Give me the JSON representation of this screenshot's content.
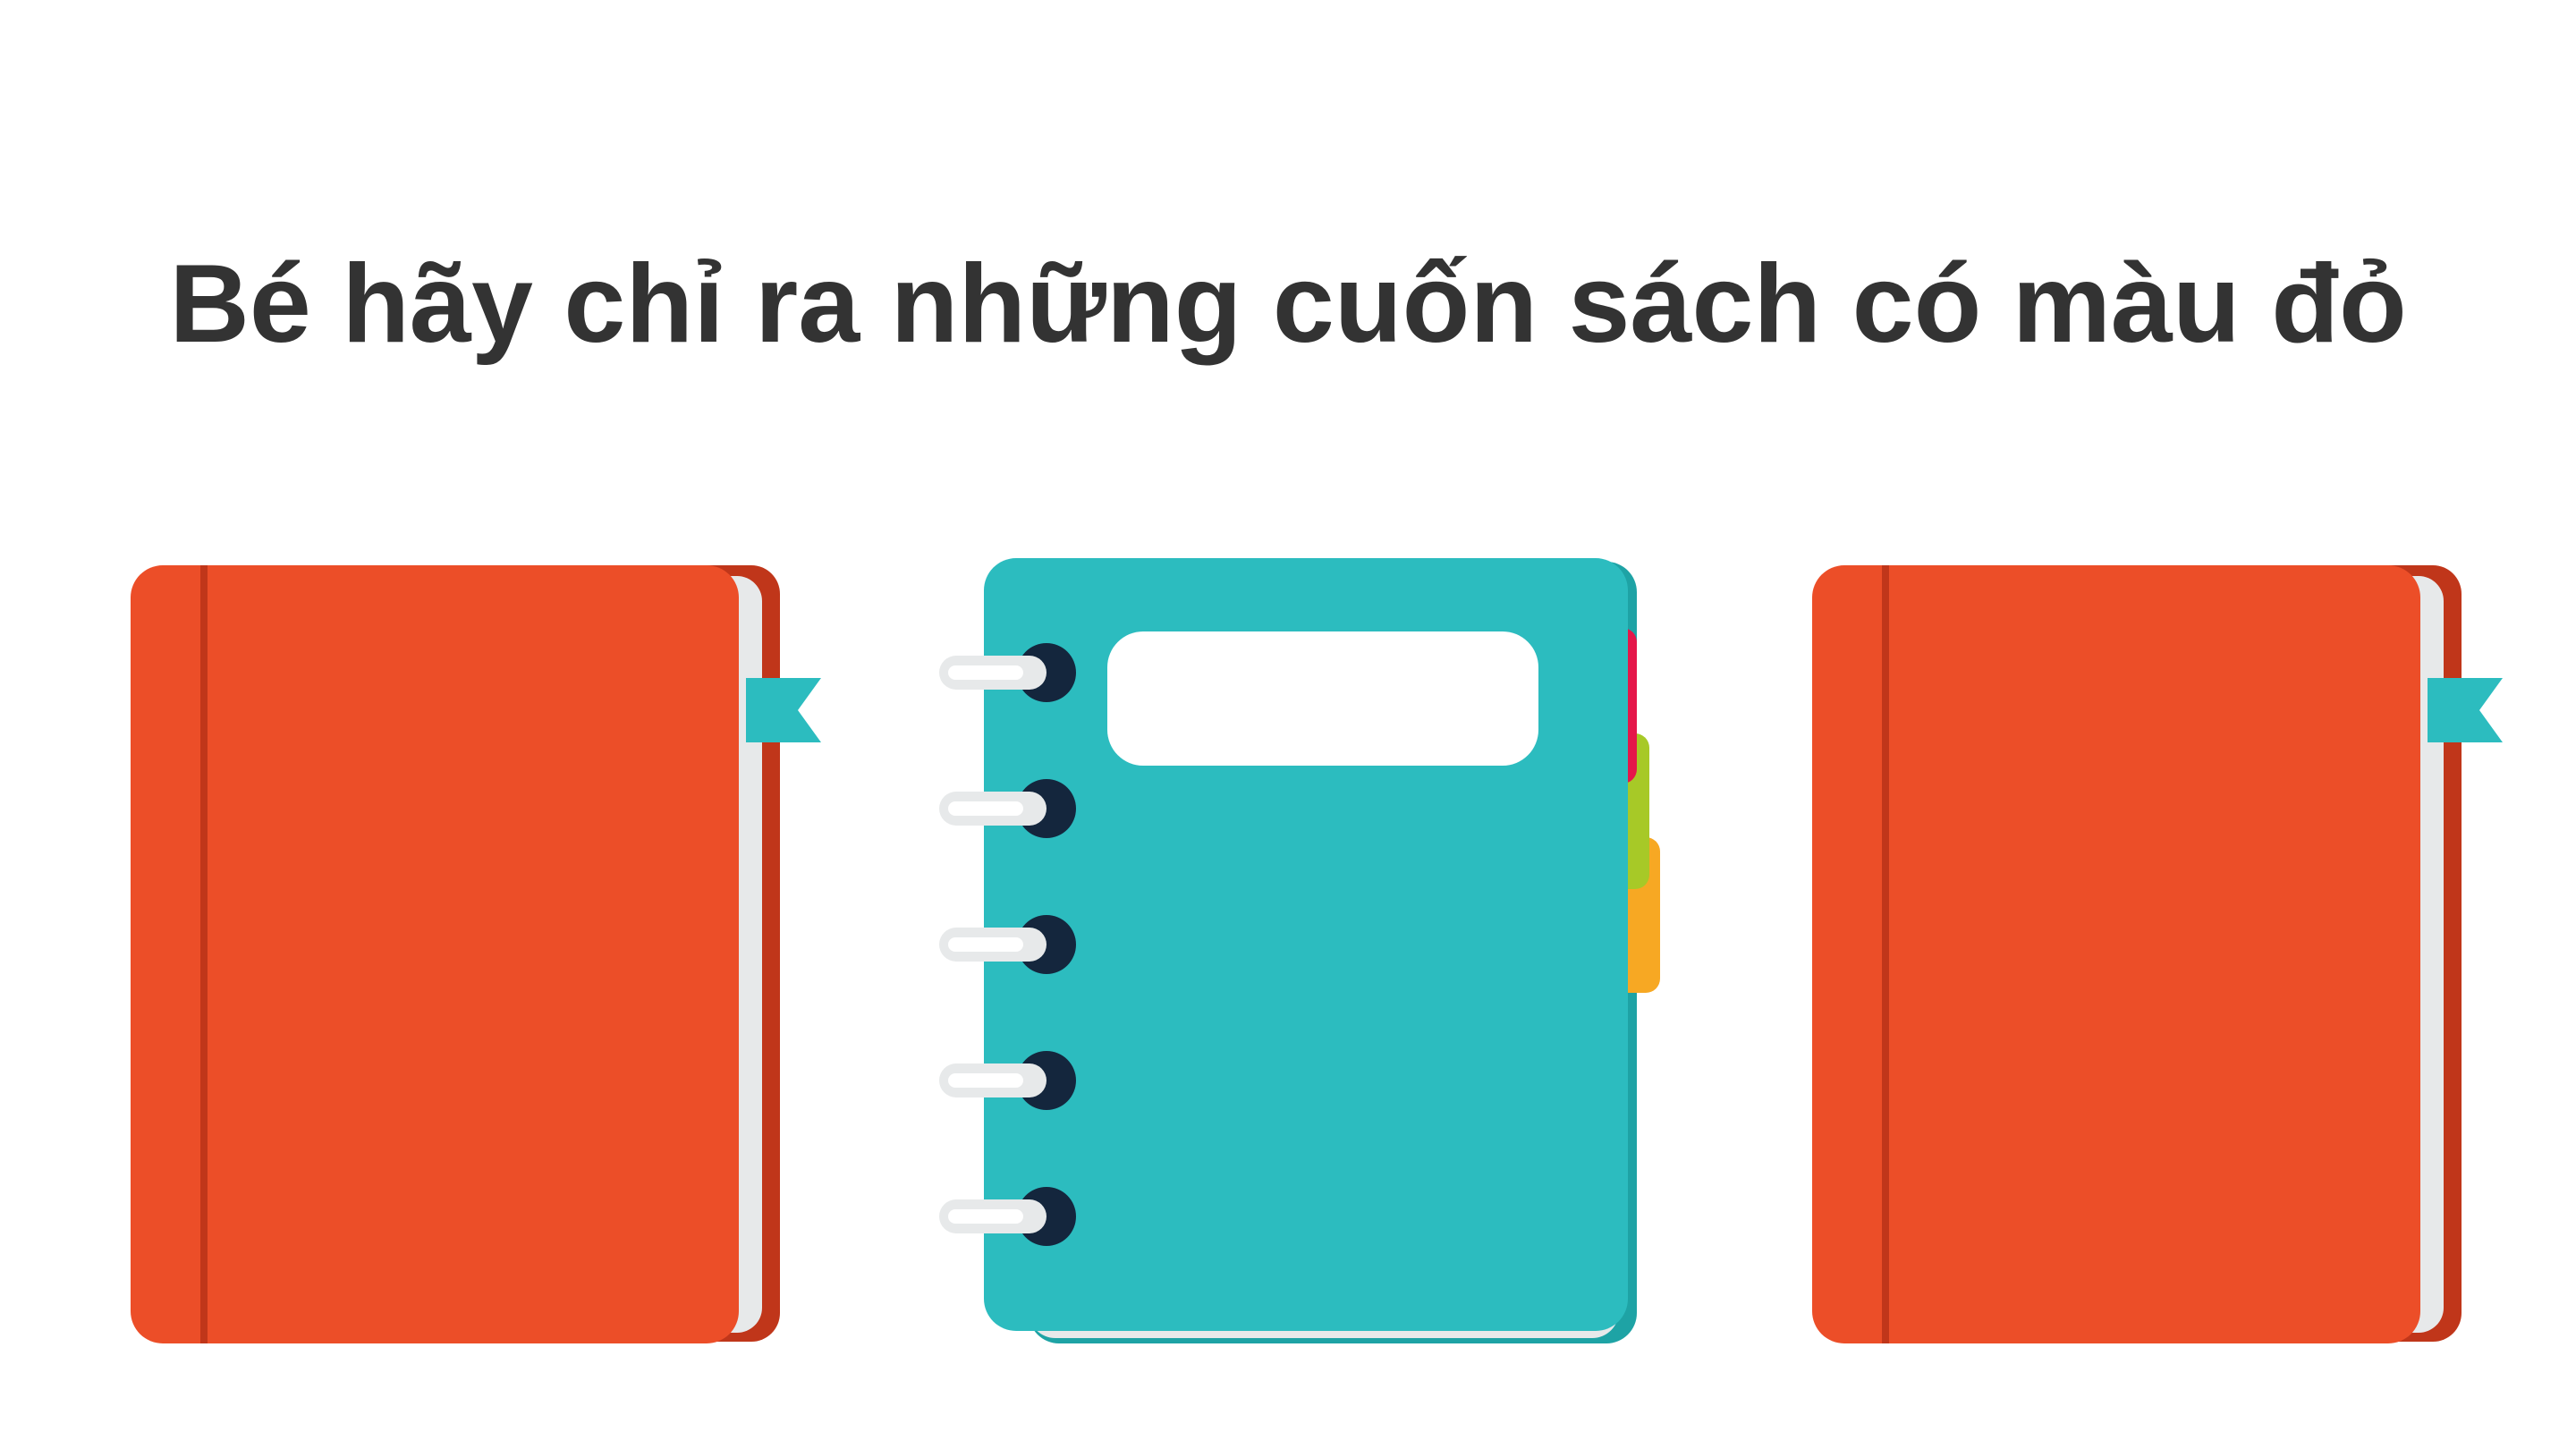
{
  "question": {
    "title": "Bé hãy chỉ ra những cuốn sách có màu đỏ"
  },
  "books": [
    {
      "name": "red-notebook-left",
      "color": "#EC4E28",
      "icon": "closed-book-with-bookmark"
    },
    {
      "name": "teal-spiral-notebook",
      "color": "#2CBCBF",
      "icon": "spiral-notebook-with-tabs"
    },
    {
      "name": "red-notebook-right",
      "color": "#EC4E28",
      "icon": "closed-book-with-bookmark"
    }
  ],
  "colors": {
    "red_cover": "#EC4E28",
    "red_spine": "#C0361A",
    "teal_cover": "#2CBCBF",
    "teal_dark": "#1EA3A5",
    "page": "#E7E9EA",
    "bookmark": "#2CBCBF",
    "ring_hole": "#14263D",
    "tab_red": "#E5174A",
    "tab_green": "#A7C927",
    "tab_orange": "#F7A823",
    "title_text": "#333333"
  }
}
